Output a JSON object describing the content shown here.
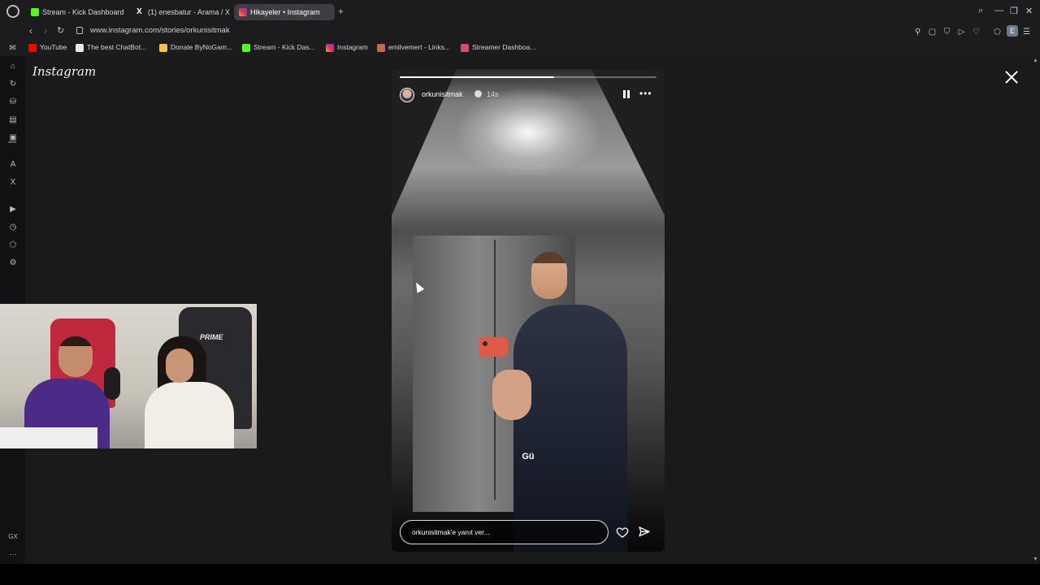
{
  "browser": {
    "tabs": [
      {
        "label": "Stream - Kick Dashboard",
        "icon": "kick-icon",
        "active": false
      },
      {
        "label": "(1) enesbatur - Arama / X",
        "icon": "x-icon",
        "active": false
      },
      {
        "label": "Hikayeler • Instagram",
        "icon": "instagram-icon",
        "active": true
      }
    ],
    "new_tab": "+",
    "url": "www.instagram.com/stories/orkunisitmak",
    "profile_initial": "E",
    "bookmarks": [
      {
        "label": "YouTube",
        "icon": "youtube-icon"
      },
      {
        "label": "The best ChatBot...",
        "icon": "chatbot-icon"
      },
      {
        "label": "Donate ByNoGam...",
        "icon": "donate-icon"
      },
      {
        "label": "Stream - Kick Das...",
        "icon": "kick-icon"
      },
      {
        "label": "Instagram",
        "icon": "instagram-icon"
      },
      {
        "label": "emilvemert - Links...",
        "icon": "linktree-icon"
      },
      {
        "label": "Streamer Dashboa...",
        "icon": "streamer-icon"
      }
    ]
  },
  "instagram": {
    "logo_text": "Instagram",
    "story": {
      "username": "orkunisitmak",
      "time": "14s",
      "progress": 0.6,
      "caption": "Gü",
      "reply_placeholder": "orkunisitmak'e yanıt ver..."
    }
  },
  "webcam": {
    "chair_brand": "PRIME"
  },
  "sidebar": {
    "bottom_label": "GX",
    "more_label": "···"
  }
}
